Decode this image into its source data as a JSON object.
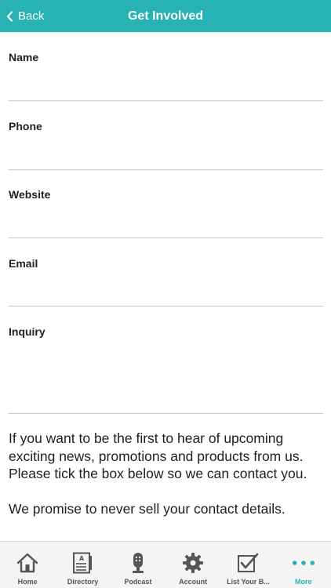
{
  "header": {
    "back_label": "Back",
    "title": "Get Involved",
    "brand_color": "#27b3b3"
  },
  "form": {
    "fields": [
      {
        "label": "Name",
        "value": ""
      },
      {
        "label": "Phone",
        "value": ""
      },
      {
        "label": "Website",
        "value": ""
      },
      {
        "label": "Email",
        "value": ""
      },
      {
        "label": "Inquiry",
        "value": ""
      }
    ]
  },
  "notice": {
    "paragraph1": "If you want to be the first to hear of upcoming exciting news, promotions and products from us. Please tick the box below so we can contact you.",
    "paragraph2": "We promise to never sell your contact details."
  },
  "tabbar": {
    "active": "More",
    "tabs": [
      {
        "label": "Home",
        "icon": "home-icon"
      },
      {
        "label": "Directory",
        "icon": "directory-icon"
      },
      {
        "label": "Podcast",
        "icon": "microphone-icon"
      },
      {
        "label": "Account",
        "icon": "gear-icon"
      },
      {
        "label": "List Your B...",
        "icon": "checkbox-icon"
      },
      {
        "label": "More",
        "icon": "more-dots-icon"
      }
    ]
  }
}
